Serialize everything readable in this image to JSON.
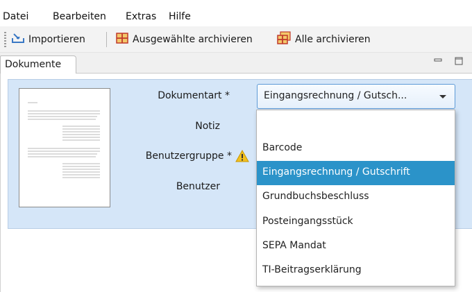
{
  "menu": [
    "Datei",
    "Bearbeiten",
    "Extras",
    "Hilfe"
  ],
  "toolbar": {
    "import_label": "Importieren",
    "archive_selected_label": "Ausgewählte archivieren",
    "archive_all_label": "Alle archivieren"
  },
  "tab": {
    "label": "Dokumente"
  },
  "form": {
    "doctype_label": "Dokumentart *",
    "note_label": "Notiz",
    "usergroup_label": "Benutzergruppe *",
    "user_label": "Benutzer",
    "doctype_value": "Eingangsrechnung / Gutsch...",
    "options": [
      "",
      "Barcode",
      "Eingangsrechnung / Gutschrift",
      "Grundbuchsbeschluss",
      "Posteingangsstück",
      "SEPA Mandat",
      "TI-Beitragserklärung"
    ],
    "selected_index": 2
  },
  "colors": {
    "form_bg": "#d5e6f8",
    "selection": "#2b93c9",
    "combo_border": "#5d9ad6",
    "warning": "#f2c01e"
  },
  "icons": [
    "import-icon",
    "archive-selected-icon",
    "archive-all-icon",
    "warning-icon",
    "minimize-icon",
    "maximize-icon",
    "chevron-down-icon"
  ]
}
